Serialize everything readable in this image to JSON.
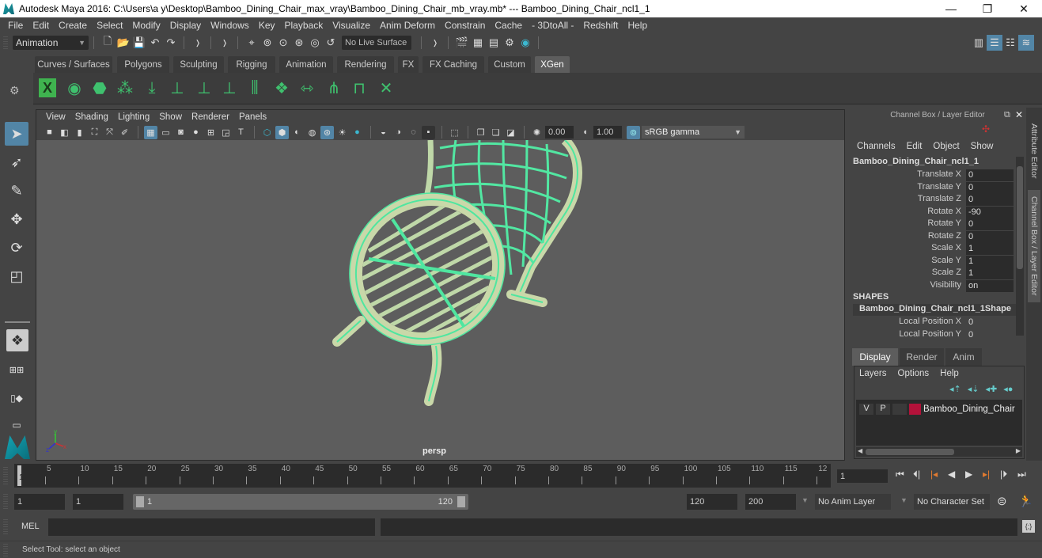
{
  "window": {
    "title": "Autodesk Maya 2016: C:\\Users\\a y\\Desktop\\Bamboo_Dining_Chair_max_vray\\Bamboo_Dining_Chair_mb_vray.mb*   ---   Bamboo_Dining_Chair_ncl1_1",
    "minimize": "—",
    "maximize": "❐",
    "close": "✕"
  },
  "menu": [
    "File",
    "Edit",
    "Create",
    "Select",
    "Modify",
    "Display",
    "Windows",
    "Key",
    "Playback",
    "Visualize",
    "Anim Deform",
    "Constrain",
    "Cache",
    "- 3DtoAll -",
    "Redshift",
    "Help"
  ],
  "status_line": {
    "mode": "Animation",
    "live_surface": "No Live Surface"
  },
  "shelf": {
    "tabs": [
      "Curves / Surfaces",
      "Polygons",
      "Sculpting",
      "Rigging",
      "Animation",
      "Rendering",
      "FX",
      "FX Caching",
      "Custom",
      "XGen"
    ],
    "active_tab": "XGen",
    "icons": [
      "xgen-editor-icon",
      "toggle-preview-icon",
      "clear-preview-icon",
      "create-description-icon",
      "place-guides-icon",
      "add-guide-icon",
      "select-guide-icon",
      "lock-guide-icon",
      "guides-icon",
      "generate-patches-icon",
      "guide-length-icon",
      "sculpt-guides-icon",
      "interactive-grooming-icon",
      "delete-guide-icon"
    ]
  },
  "viewport": {
    "menu": [
      "View",
      "Shading",
      "Lighting",
      "Show",
      "Renderer",
      "Panels"
    ],
    "exposure": "0.00",
    "gamma": "1.00",
    "color_space": "sRGB gamma",
    "camera_label": "persp",
    "axis": {
      "x": "x",
      "y": "y",
      "z": "z"
    }
  },
  "channel_box": {
    "header": "Channel Box / Layer Editor",
    "menu": [
      "Channels",
      "Edit",
      "Object",
      "Show"
    ],
    "object_name": "Bamboo_Dining_Chair_ncl1_1",
    "channels": [
      {
        "label": "Translate X",
        "value": "0"
      },
      {
        "label": "Translate Y",
        "value": "0"
      },
      {
        "label": "Translate Z",
        "value": "0"
      },
      {
        "label": "Rotate X",
        "value": "-90"
      },
      {
        "label": "Rotate Y",
        "value": "0"
      },
      {
        "label": "Rotate Z",
        "value": "0"
      },
      {
        "label": "Scale X",
        "value": "1"
      },
      {
        "label": "Scale Y",
        "value": "1"
      },
      {
        "label": "Scale Z",
        "value": "1"
      },
      {
        "label": "Visibility",
        "value": "on"
      }
    ],
    "shapes_header": "SHAPES",
    "shape_name": "Bamboo_Dining_Chair_ncl1_1Shape",
    "shape_channels": [
      {
        "label": "Local Position X",
        "value": "0"
      },
      {
        "label": "Local Position Y",
        "value": "0"
      }
    ]
  },
  "layer_editor": {
    "tabs": [
      "Display",
      "Render",
      "Anim"
    ],
    "active_tab": "Display",
    "menu": [
      "Layers",
      "Options",
      "Help"
    ],
    "layers": [
      {
        "v": "V",
        "p": "P",
        "color": "#b3123a",
        "name": "Bamboo_Dining_Chair"
      }
    ]
  },
  "side_tabs": [
    "Attribute Editor",
    "Channel Box / Layer Editor"
  ],
  "time_slider": {
    "ticks": [
      "5",
      "10",
      "15",
      "20",
      "25",
      "30",
      "35",
      "40",
      "45",
      "50",
      "55",
      "60",
      "65",
      "70",
      "75",
      "80",
      "85",
      "90",
      "95",
      "100",
      "105",
      "110",
      "115",
      "12"
    ],
    "current_frame_marker": "1",
    "current_frame": "1"
  },
  "range": {
    "start": "1",
    "playback_start": "1",
    "slider_start_label": "1",
    "slider_end_label": "120",
    "playback_end": "120",
    "end": "200",
    "anim_layer": "No Anim Layer",
    "character_set": "No Character Set"
  },
  "command_line": {
    "label": "MEL"
  },
  "help_line": "Select Tool: select an object"
}
